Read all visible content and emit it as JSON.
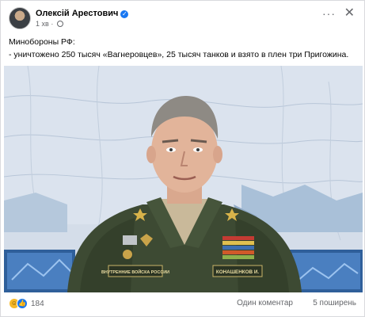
{
  "post": {
    "author": "Олексій Арестович",
    "time": "1 хв",
    "more_glyph": "···",
    "close_glyph": "✕",
    "text_line1": "Минобороны РФ:",
    "text_line2": "- уничтожено 250 тысяч «Вагнеровцев», 25 тысяч танков и взято в плен три Пригожина.",
    "reaction_count": "184",
    "comments": "Один коментар",
    "shares": "5 поширень"
  },
  "image": {
    "name_tag_left": "ВНУТРЕННИЕ ВОЙСКА РОССИИ",
    "name_tag_right": "КОНАШЕНКОВ И."
  },
  "colors": {
    "like_blue": "#1877f2",
    "meta_gray": "#65676b",
    "uniform_green": "#3d4a33",
    "map_bg": "#d4dde9"
  },
  "icons": {
    "more": "more-icon",
    "close": "close-icon",
    "verified": "verified-badge-icon",
    "privacy": "globe-icon",
    "reaction_laugh": "haha-reaction-icon",
    "reaction_like": "like-reaction-icon"
  }
}
